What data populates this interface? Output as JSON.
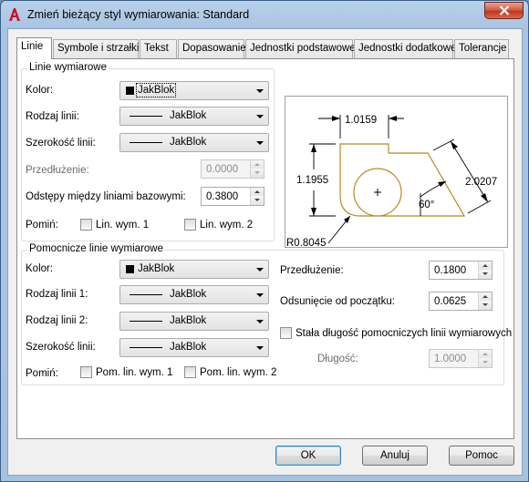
{
  "window": {
    "title": "Zmień bieżący styl wymiarowania: Standard",
    "colors": {
      "title_bar": "#a9c4e2",
      "close": "#c2371f",
      "preview_geometry": "#b58b1e"
    }
  },
  "tabs": [
    {
      "label": "Linie",
      "active": true
    },
    {
      "label": "Symbole i strzałki"
    },
    {
      "label": "Tekst"
    },
    {
      "label": "Dopasowanie"
    },
    {
      "label": "Jednostki podstawowe"
    },
    {
      "label": "Jednostki dodatkowe"
    },
    {
      "label": "Tolerancje"
    }
  ],
  "dim_lines": {
    "title": "Linie wymiarowe",
    "color_label": "Kolor:",
    "color_value": "JakBlok",
    "linetype_label": "Rodzaj linii:",
    "linetype_value": "JakBlok",
    "lineweight_label": "Szerokość linii:",
    "lineweight_value": "JakBlok",
    "extension_label": "Przedłużenie:",
    "extension_value": "0.0000",
    "baseline_label": "Odstępy między liniami bazowymi:",
    "baseline_value": "0.3800",
    "suppress_label": "Pomiń:",
    "suppress1": "Lin. wym. 1",
    "suppress2": "Lin. wym. 2"
  },
  "ext_lines": {
    "title": "Pomocnicze linie wymiarowe",
    "color_label": "Kolor:",
    "color_value": "JakBlok",
    "linetype1_label": "Rodzaj linii 1:",
    "linetype1_value": "JakBlok",
    "linetype2_label": "Rodzaj linii 2:",
    "linetype2_value": "JakBlok",
    "lineweight_label": "Szerokość linii:",
    "lineweight_value": "JakBlok",
    "suppress_label": "Pomiń:",
    "suppress1": "Pom. lin. wym. 1",
    "suppress2": "Pom. lin. wym. 2",
    "extend_label": "Przedłużenie:",
    "extend_value": "0.1800",
    "offset_label": "Odsunięcie od początku:",
    "offset_value": "0.0625",
    "fixed_label": "Stała długość pomocniczych linii wymiarowych",
    "length_label": "Długość:",
    "length_value": "1.0000"
  },
  "preview": {
    "top_dim": "1.0159",
    "left_dim": "1.1955",
    "right_dim": "2.0207",
    "angle_dim": "60°",
    "radius_dim": "R0.8045"
  },
  "buttons": {
    "ok": "OK",
    "cancel": "Anuluj",
    "help": "Pomoc"
  }
}
